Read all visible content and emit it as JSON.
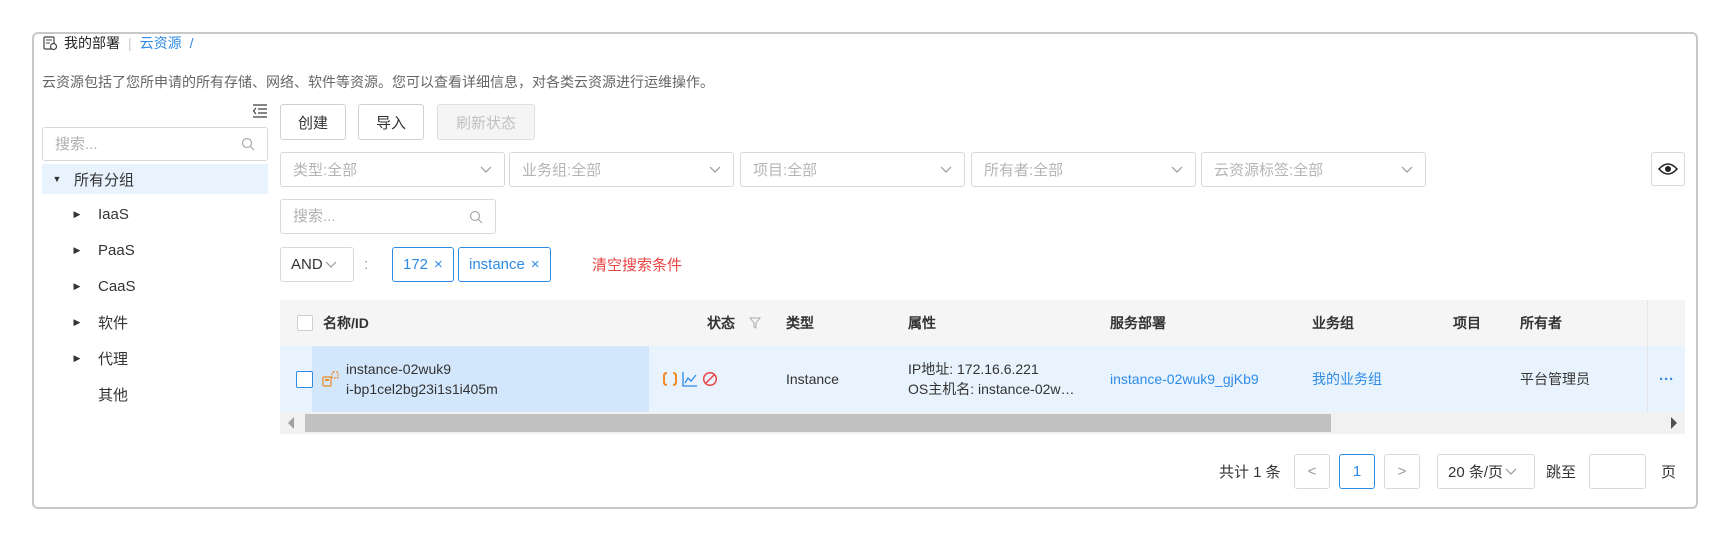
{
  "breadcrumb": {
    "home": "我的部署",
    "current": "云资源",
    "trailing": "/"
  },
  "description": "云资源包括了您所申请的所有存储、网络、软件等资源。您可以查看详细信息，对各类云资源进行运维操作。",
  "sidebar": {
    "search_placeholder": "搜索...",
    "tree": {
      "root": "所有分组",
      "children": [
        "IaaS",
        "PaaS",
        "CaaS",
        "软件",
        "代理"
      ],
      "leaf": "其他"
    }
  },
  "toolbar": {
    "create": "创建",
    "import": "导入",
    "refresh": "刷新状态"
  },
  "filters": {
    "type": "类型:全部",
    "business_group": "业务组:全部",
    "project": "项目:全部",
    "owner": "所有者:全部",
    "tags": "云资源标签:全部"
  },
  "search": {
    "placeholder": "搜索...",
    "logic": "AND",
    "separator": ":",
    "tags": [
      "172",
      "instance"
    ],
    "clear": "清空搜索条件"
  },
  "table": {
    "columns": {
      "name": "名称/ID",
      "status": "状态",
      "type": "类型",
      "attributes": "属性",
      "service_deployment": "服务部署",
      "business_group": "业务组",
      "project": "项目",
      "owner": "所有者"
    },
    "rows": [
      {
        "name": "instance-02wuk9",
        "id": "i-bp1cel2bg23i1s1i405m",
        "type": "Instance",
        "attr_ip": "IP地址: 172.16.6.221",
        "attr_host": "OS主机名: instance-02w…",
        "service_deployment": "instance-02wuk9_gjKb9",
        "business_group": "我的业务组",
        "project": "",
        "owner": "平台管理员",
        "more": "···"
      }
    ]
  },
  "pagination": {
    "total": "共计 1 条",
    "prev": "<",
    "current": "1",
    "next": ">",
    "page_size": "20 条/页",
    "jump_label": "跳至",
    "page_label": "页"
  },
  "colors": {
    "accent": "#2f8be6",
    "danger": "#e84545",
    "row_selected": "#e8f3fe",
    "orange_icon": "#f08a24"
  }
}
